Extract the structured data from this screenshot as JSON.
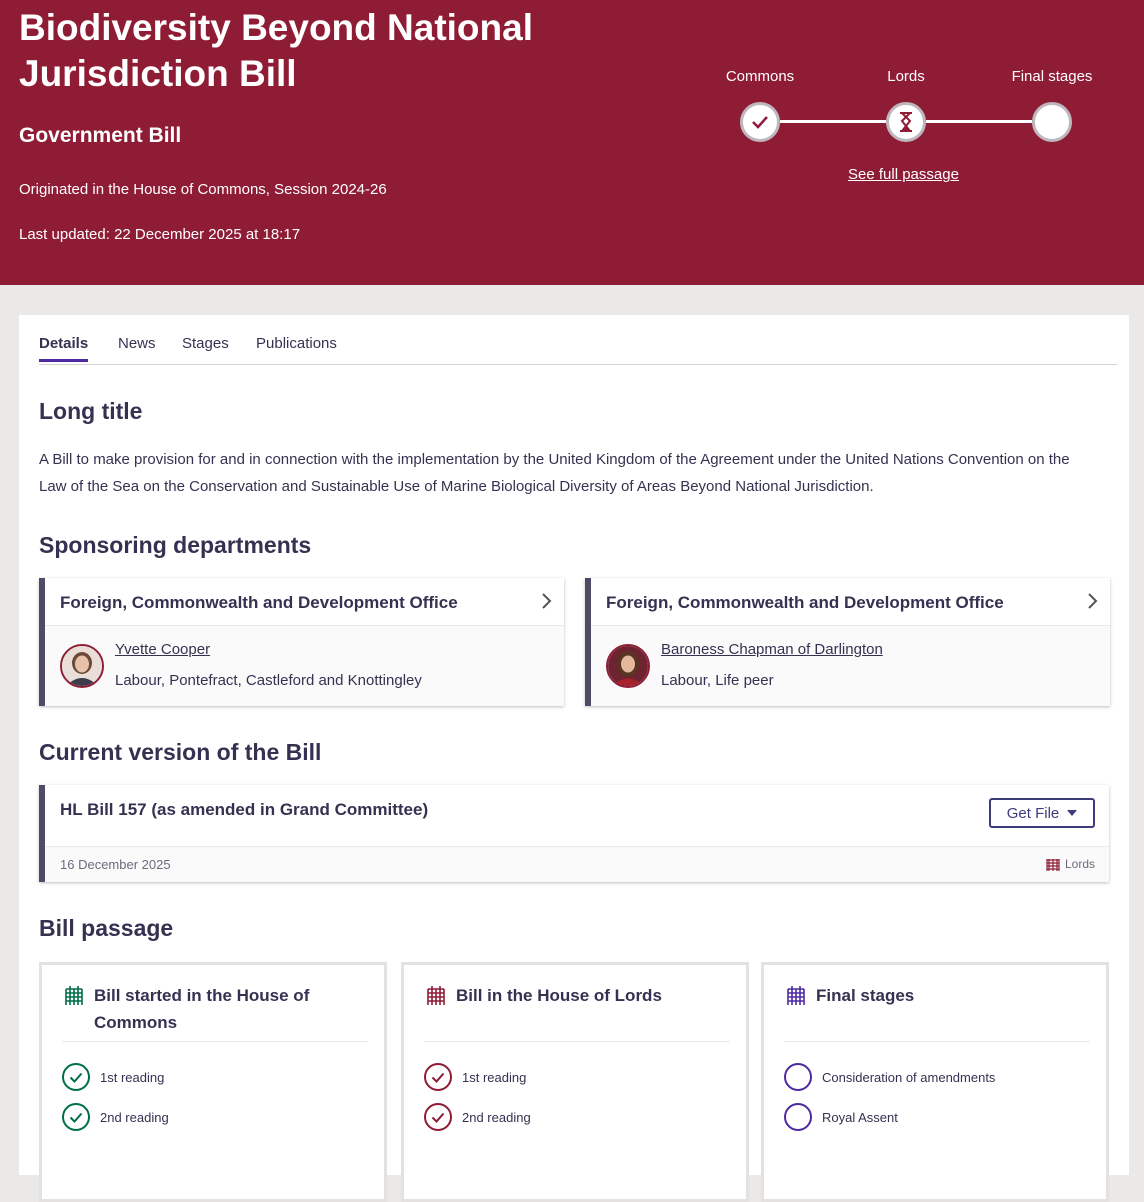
{
  "bill": {
    "title": "Biodiversity Beyond National Jurisdiction Bill",
    "type": "Government Bill",
    "origin": "Originated in the House of Commons, Session 2024-26",
    "last_updated": "Last updated: 22 December 2025 at 18:17"
  },
  "progress": {
    "stages": [
      {
        "label": "Commons",
        "state": "complete"
      },
      {
        "label": "Lords",
        "state": "current"
      },
      {
        "label": "Final stages",
        "state": "pending"
      }
    ],
    "passage_link": "See full passage"
  },
  "tabs": [
    "Details",
    "News",
    "Stages",
    "Publications"
  ],
  "long_title": {
    "heading": "Long title",
    "text": "A Bill to make provision for and in connection with the implementation by the United Kingdom of the Agreement under the United Nations Convention on the Law of the Sea on the Conservation and Sustainable Use of Marine Biological Diversity of Areas Beyond National Jurisdiction."
  },
  "sponsoring": {
    "heading": "Sponsoring departments",
    "departments": [
      {
        "name": "Foreign, Commonwealth and Development Office",
        "member": "Yvette Cooper",
        "info": "Labour, Pontefract, Castleford and Knottingley"
      },
      {
        "name": "Foreign, Commonwealth and Development Office",
        "member": "Baroness Chapman of Darlington",
        "info": "Labour, Life peer"
      }
    ]
  },
  "current_version": {
    "heading": "Current version of the Bill",
    "title": "HL Bill 157 (as amended in Grand Committee)",
    "button": "Get File",
    "date": "16 December 2025",
    "house": "Lords"
  },
  "passage": {
    "heading": "Bill passage",
    "boxes": [
      {
        "title": "Bill started in the House of Commons",
        "color": "#006e46",
        "steps": [
          "1st reading",
          "2nd reading"
        ]
      },
      {
        "title": "Bill in the House of Lords",
        "color": "#8f1c35",
        "steps": [
          "1st reading",
          "2nd reading"
        ]
      },
      {
        "title": "Final stages",
        "color": "#4d2aa3",
        "steps": [
          "Consideration of amendments",
          "Royal Assent"
        ]
      }
    ]
  },
  "colors": {
    "header_bg": "#8f1c35",
    "commons_green": "#006e46",
    "lords_red": "#8f1c35",
    "final_purple": "#4d2aa3"
  }
}
